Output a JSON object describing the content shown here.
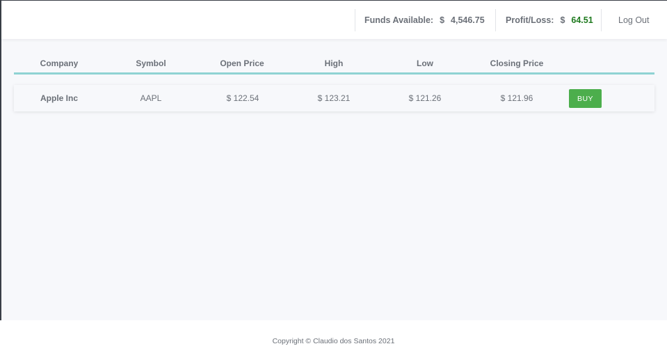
{
  "header": {
    "funds": {
      "label": "Funds Available:",
      "currency": "$",
      "value": "4,546.75"
    },
    "profit": {
      "label": "Profit/Loss:",
      "currency": "$",
      "value": "64.51",
      "color": "#1f7a1f"
    },
    "logout_label": "Log Out"
  },
  "table": {
    "columns": [
      "Company",
      "Symbol",
      "Open Price",
      "High",
      "Low",
      "Closing Price"
    ],
    "rows": [
      {
        "company": "Apple Inc",
        "symbol": "AAPL",
        "open": "$ 122.54",
        "high": "$ 123.21",
        "low": "$ 121.26",
        "close": "$ 121.96",
        "action": "BUY"
      }
    ],
    "accent_color": "#8fd3d3",
    "buy_color": "#4cae4c"
  },
  "footer": {
    "copyright": "Copyright © Claudio dos Santos 2021"
  }
}
